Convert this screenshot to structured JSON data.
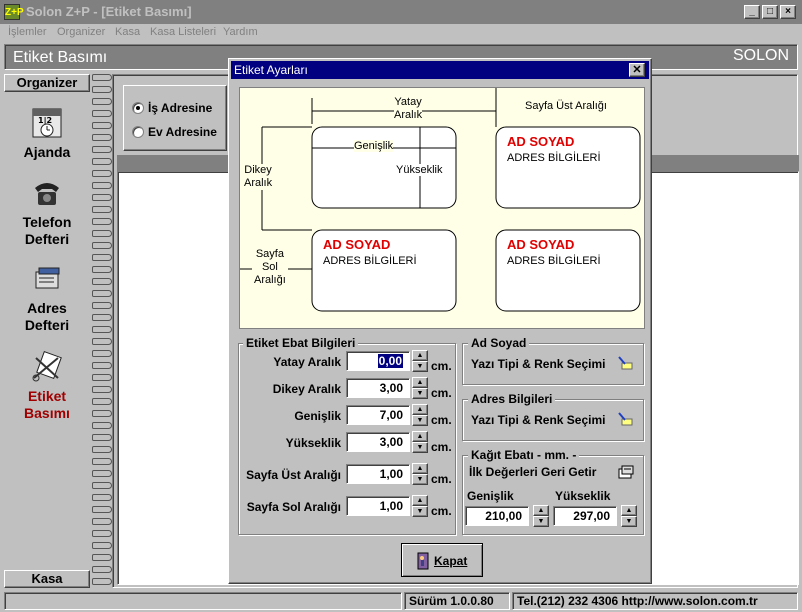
{
  "window": {
    "title": "Solon Z+P - [Etiket Basımı]",
    "icon": "Z+P"
  },
  "menu": [
    "İşlemler",
    "Organizer",
    "Kasa",
    "Kasa Listeleri",
    "Yardım"
  ],
  "header": {
    "title": "Etiket Basımı",
    "brand": "SOLON"
  },
  "sidebar": {
    "top": "Organizer",
    "items": [
      {
        "label1": "Ajanda",
        "label2": "",
        "icon": "calendar-icon"
      },
      {
        "label1": "Telefon",
        "label2": "Defteri",
        "icon": "phone-icon"
      },
      {
        "label1": "Adres",
        "label2": "Defteri",
        "icon": "address-book-icon"
      },
      {
        "label1": "Etiket",
        "label2": "Basımı",
        "icon": "label-print-icon"
      }
    ],
    "bottom": "Kasa"
  },
  "main": {
    "radios": [
      "İş Adresine",
      "Ev Adresine"
    ],
    "selected": 0
  },
  "dialog": {
    "title": "Etiket Ayarları",
    "preview": {
      "yatay": [
        "Yatay",
        "Aralık"
      ],
      "sayfa_ust": "Sayfa Üst Aralığı",
      "genislik": "Genişlik",
      "yukseklik": "Yükseklik",
      "dikey": [
        "Dikey",
        "Aralık"
      ],
      "sayfa_sol": [
        "Sayfa",
        "Sol",
        "Aralığı"
      ],
      "name": "AD SOYAD",
      "addr": "ADRES BİLGİLERİ"
    },
    "ebat": {
      "title": "Etiket Ebat Bilgileri",
      "unit": "cm.",
      "fields": [
        {
          "label": "Yatay Aralık",
          "value": "0,00"
        },
        {
          "label": "Dikey Aralık",
          "value": "3,00"
        },
        {
          "label": "Genişlik",
          "value": "7,00"
        },
        {
          "label": "Yükseklik",
          "value": "3,00"
        },
        {
          "label": "Sayfa Üst Aralığı",
          "value": "1,00"
        },
        {
          "label": "Sayfa Sol Aralığı",
          "value": "1,00"
        }
      ]
    },
    "adsoyad": {
      "title": "Ad Soyad",
      "button": "Yazı Tipi & Renk Seçimi"
    },
    "adres": {
      "title": "Adres Bilgileri",
      "button": "Yazı Tipi & Renk Seçimi"
    },
    "kagit": {
      "title": "Kağıt Ebatı - mm. -",
      "reset": "İlk Değerleri Geri Getir",
      "genislik_label": "Genişlik",
      "genislik": "210,00",
      "yukseklik_label": "Yükseklik",
      "yukseklik": "297,00"
    },
    "close_label": "Kapat"
  },
  "status": {
    "version": "Sürüm 1.0.0.80",
    "contact": "Tel.(212) 232 4306  http://www.solon.com.tr"
  }
}
